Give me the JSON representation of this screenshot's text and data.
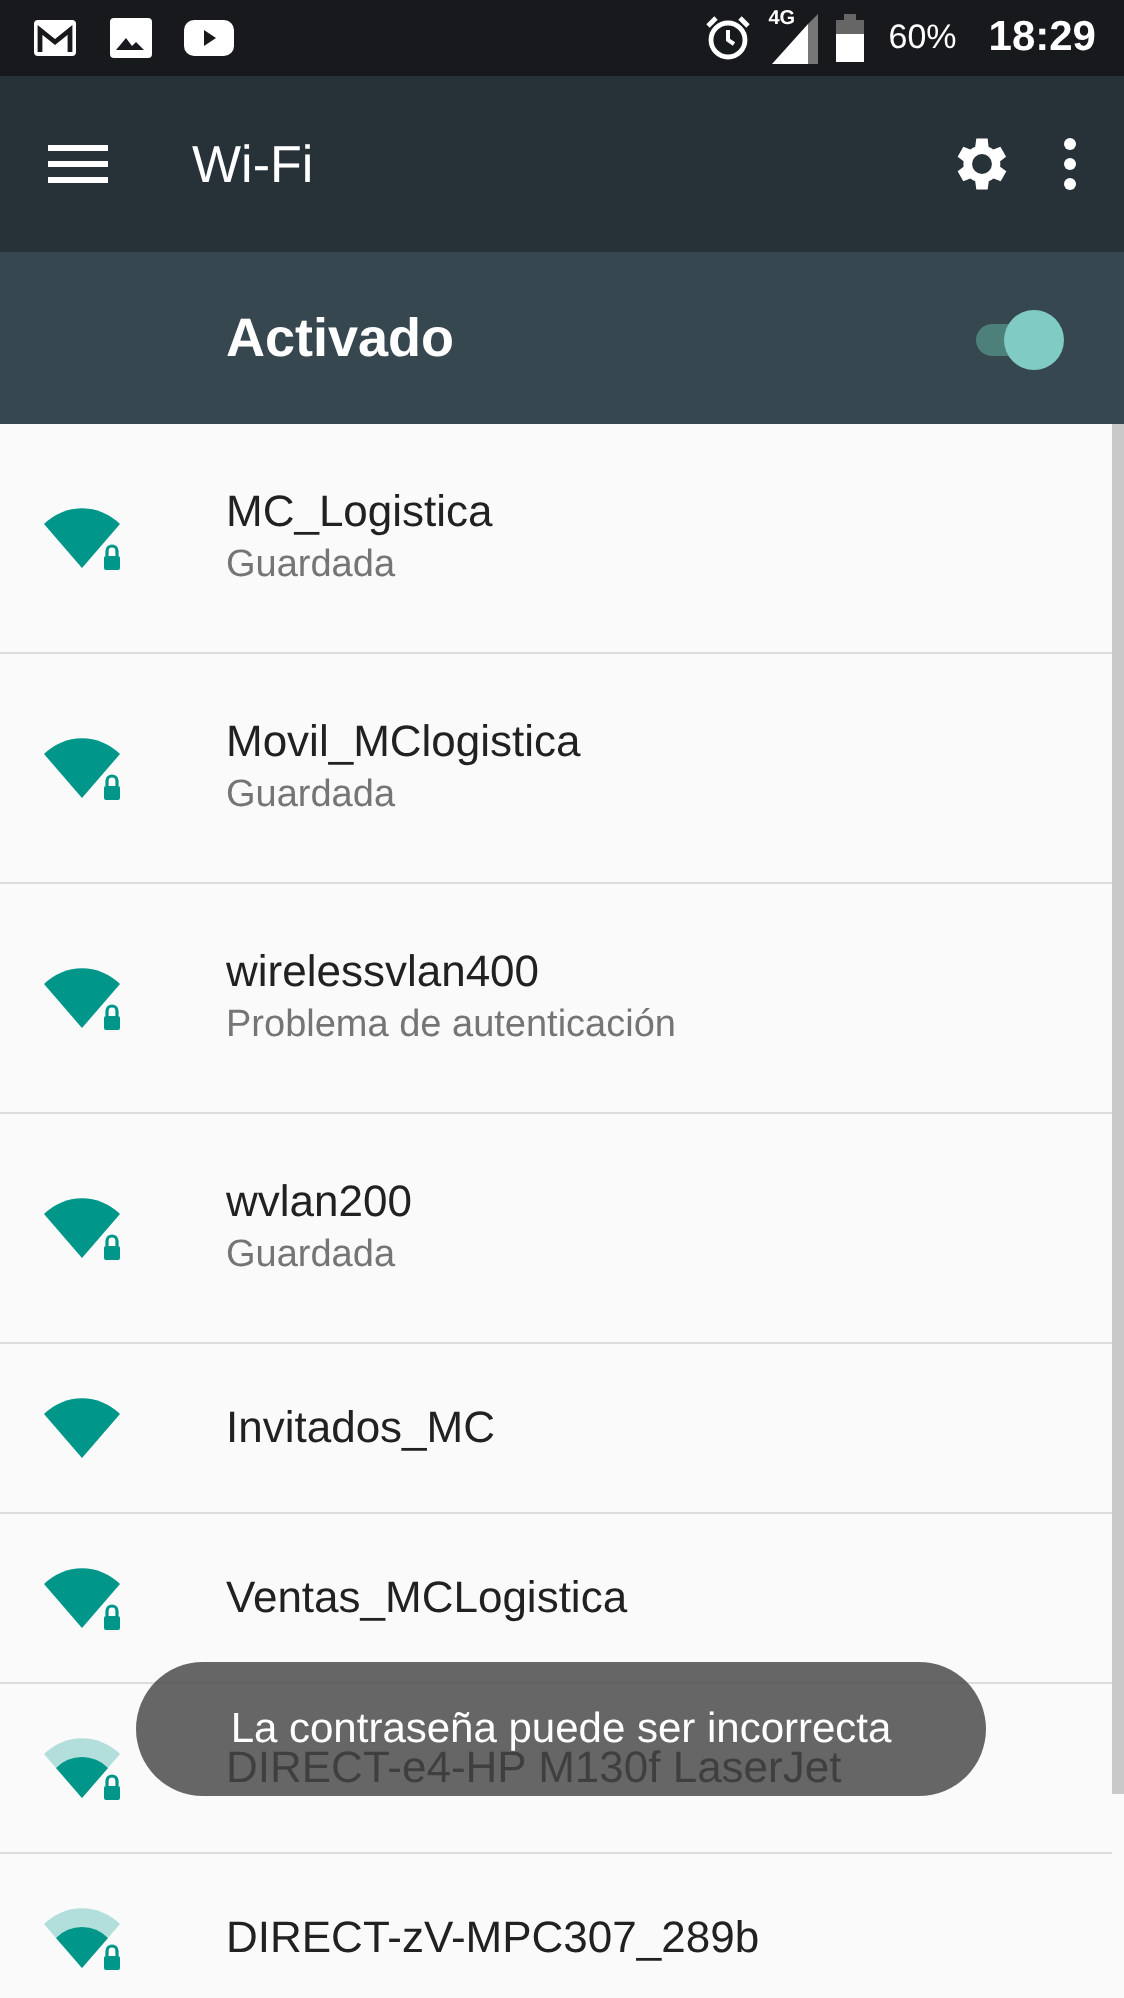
{
  "status_bar": {
    "network": "4G",
    "battery": "60%",
    "time": "18:29"
  },
  "toolbar": {
    "title": "Wi-Fi"
  },
  "master_switch": {
    "label": "Activado",
    "on": true
  },
  "networks": [
    {
      "name": "MC_Logistica",
      "status": "Guardada",
      "kind": "strong",
      "locked": true
    },
    {
      "name": "Movil_MClogistica",
      "status": "Guardada",
      "kind": "strong",
      "locked": true
    },
    {
      "name": "wirelessvlan400",
      "status": "Problema de autenticación",
      "kind": "strong",
      "locked": true
    },
    {
      "name": "wvlan200",
      "status": "Guardada",
      "kind": "strong",
      "locked": true
    },
    {
      "name": "Invitados_MC",
      "kind": "strong",
      "locked": false
    },
    {
      "name": "Ventas_MCLogistica",
      "kind": "strong",
      "locked": true
    },
    {
      "name": "DIRECT-e4-HP M130f LaserJet",
      "kind": "medium",
      "locked": true
    },
    {
      "name": "DIRECT-zV-MPC307_289b",
      "kind": "medium",
      "locked": true
    }
  ],
  "toast": {
    "message": "La contraseña puede ser incorrecta"
  }
}
